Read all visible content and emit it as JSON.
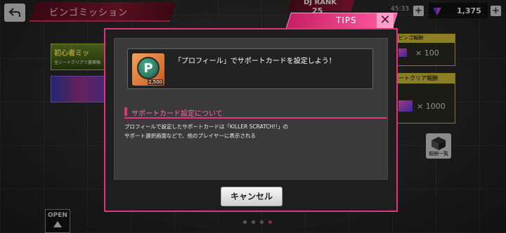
{
  "header": {
    "title": "ビンゴミッション",
    "dj_rank_label": "DJ RANK",
    "dj_rank_value": "25",
    "time": "45:33",
    "gem_count": "1,375"
  },
  "tips": {
    "label": "TIPS",
    "close": "✕"
  },
  "left_panel": {
    "banner1_title": "初心者ミッ",
    "banner1_sub": "全シートクリアで豪華報"
  },
  "right_panel": {
    "reward1_header": "ビンゴ報酬",
    "reward1_count": "× 100",
    "reward2_header": "ートクリア報酬",
    "reward2_count": "× 1000",
    "reward_list_label": "報酬一覧"
  },
  "open_button": "OPEN",
  "modal": {
    "card_number": "2,500",
    "card_letter": "P",
    "card_title": "「プロフィール」でサポートカードを設定しよう！",
    "section_title": "サポートカード設定について",
    "description_line1": "プロフィールで設定したサポートカードは「KILLER SCRATCH!!」の",
    "description_line2": "サポート選択画面などで、他のプレイヤーに表示される",
    "cancel_label": "キャンセル"
  },
  "colors": {
    "accent_pink": "#e0357a",
    "header_red": "#8a1730",
    "reward_gold": "#d8c23a"
  }
}
